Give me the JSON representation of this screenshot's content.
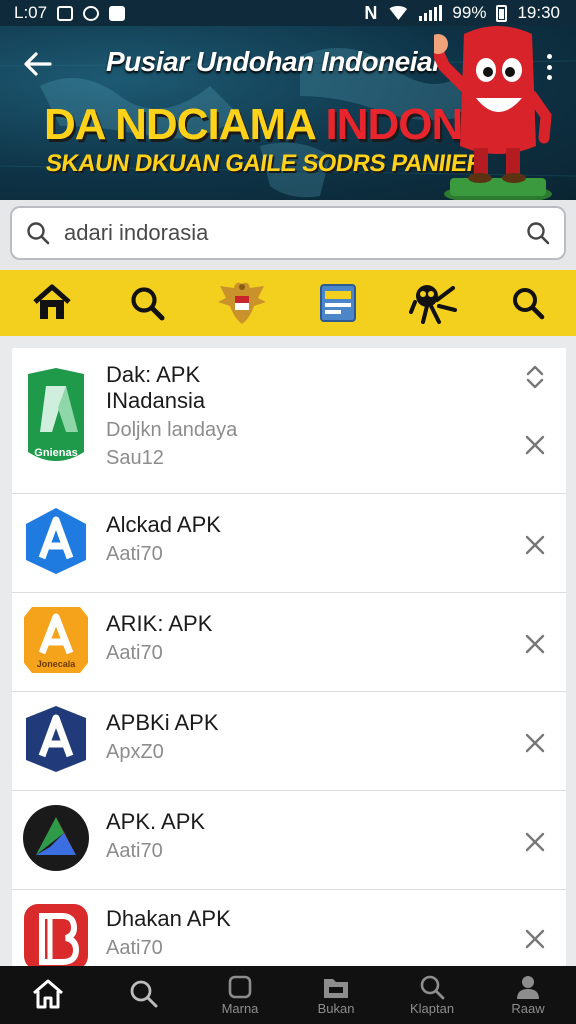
{
  "status_bar": {
    "time_left": "L:07",
    "battery_pct": "99%",
    "time_right": "19:30"
  },
  "banner": {
    "title": "Pusiar Undohan Indoneiai",
    "headline_a": "DA NDCIAMA",
    "headline_b": "INDONSI",
    "subtitle": "SKAUN DKUAN GAILE SODRS PANIIER"
  },
  "search": {
    "value": "adari indorasia"
  },
  "toolbar": {
    "items": [
      "home-icon",
      "search-icon",
      "garuda-emblem-icon",
      "card-icon",
      "bug-icon",
      "search-icon"
    ]
  },
  "list": {
    "items": [
      {
        "title_line1": "Dak: APK",
        "title_line2": "INadansia",
        "meta_line1": "Doljkn landaya",
        "meta_line2": "Sau12",
        "icon_label": "Gnienas",
        "icon_color": "#1f9a4a"
      },
      {
        "title_line1": "Alckad APK",
        "meta_line1": "Aati70",
        "icon_color": "#1f7be0"
      },
      {
        "title_line1": "ARIK: APK",
        "meta_line1": "Aati70",
        "icon_label": "Jonecala",
        "icon_color": "#f5a31a"
      },
      {
        "title_line1": "APBKi APK",
        "meta_line1": "ApxZ0",
        "icon_color": "#203a7a"
      },
      {
        "title_line1": "APK. APK",
        "meta_line1": "Aati70",
        "icon_color": "#1a1a1a"
      },
      {
        "title_line1": "Dhakan APK",
        "meta_line1": "Aati70",
        "icon_color": "#d92b2b"
      }
    ]
  },
  "bottom_nav": {
    "items": [
      {
        "label": "",
        "icon": "home-icon"
      },
      {
        "label": "",
        "icon": "search-icon"
      },
      {
        "label": "Marna",
        "icon": "square-icon"
      },
      {
        "label": "Bukan",
        "icon": "folder-icon"
      },
      {
        "label": "Klaptan",
        "icon": "search-icon"
      },
      {
        "label": "Raaw",
        "icon": "profile-icon"
      }
    ]
  }
}
